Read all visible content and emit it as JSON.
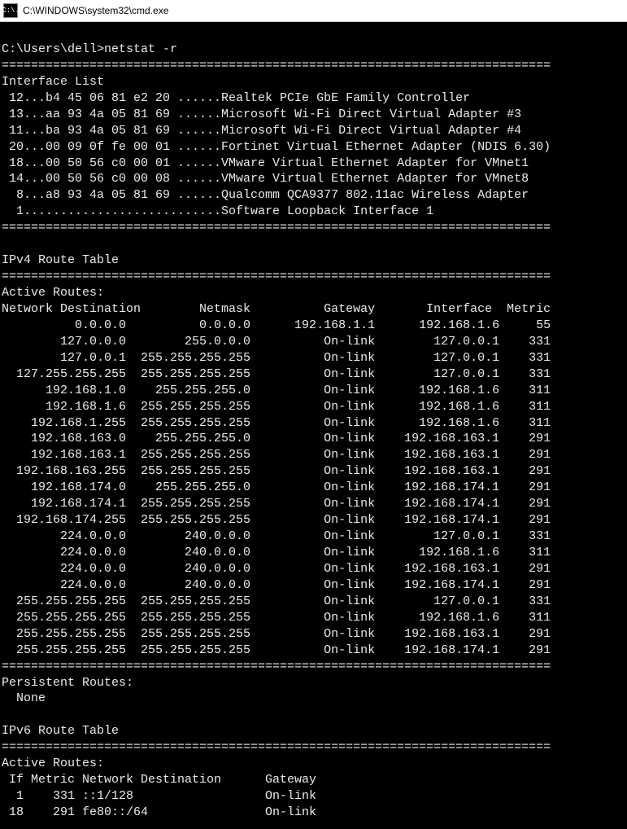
{
  "window": {
    "icon_text": "C:\\.",
    "title": "C:\\WINDOWS\\system32\\cmd.exe"
  },
  "terminal": {
    "prompt": "C:\\Users\\dell>",
    "command": "netstat -r",
    "divider": "===========================================================================",
    "interface_list_header": "Interface List",
    "interfaces": [
      {
        "idx": "12",
        "mac": "b4 45 06 81 e2 20",
        "name": "Realtek PCIe GbE Family Controller"
      },
      {
        "idx": "13",
        "mac": "aa 93 4a 05 81 69",
        "name": "Microsoft Wi-Fi Direct Virtual Adapter #3"
      },
      {
        "idx": "11",
        "mac": "ba 93 4a 05 81 69",
        "name": "Microsoft Wi-Fi Direct Virtual Adapter #4"
      },
      {
        "idx": "20",
        "mac": "00 09 0f fe 00 01",
        "name": "Fortinet Virtual Ethernet Adapter (NDIS 6.30)"
      },
      {
        "idx": "18",
        "mac": "00 50 56 c0 00 01",
        "name": "VMware Virtual Ethernet Adapter for VMnet1"
      },
      {
        "idx": "14",
        "mac": "00 50 56 c0 00 08",
        "name": "VMware Virtual Ethernet Adapter for VMnet8"
      },
      {
        "idx": "8",
        "mac": "a8 93 4a 05 81 69",
        "name": "Qualcomm QCA9377 802.11ac Wireless Adapter"
      }
    ],
    "loopback_line": "  1...........................Software Loopback Interface 1",
    "ipv4_header": "IPv4 Route Table",
    "active_routes_header": "Active Routes:",
    "ipv4_columns": "Network Destination        Netmask          Gateway       Interface  Metric",
    "ipv4_routes": [
      {
        "dest": "0.0.0.0",
        "mask": "0.0.0.0",
        "gw": "192.168.1.1",
        "iface": "192.168.1.6",
        "metric": "55"
      },
      {
        "dest": "127.0.0.0",
        "mask": "255.0.0.0",
        "gw": "On-link",
        "iface": "127.0.0.1",
        "metric": "331"
      },
      {
        "dest": "127.0.0.1",
        "mask": "255.255.255.255",
        "gw": "On-link",
        "iface": "127.0.0.1",
        "metric": "331"
      },
      {
        "dest": "127.255.255.255",
        "mask": "255.255.255.255",
        "gw": "On-link",
        "iface": "127.0.0.1",
        "metric": "331"
      },
      {
        "dest": "192.168.1.0",
        "mask": "255.255.255.0",
        "gw": "On-link",
        "iface": "192.168.1.6",
        "metric": "311"
      },
      {
        "dest": "192.168.1.6",
        "mask": "255.255.255.255",
        "gw": "On-link",
        "iface": "192.168.1.6",
        "metric": "311"
      },
      {
        "dest": "192.168.1.255",
        "mask": "255.255.255.255",
        "gw": "On-link",
        "iface": "192.168.1.6",
        "metric": "311"
      },
      {
        "dest": "192.168.163.0",
        "mask": "255.255.255.0",
        "gw": "On-link",
        "iface": "192.168.163.1",
        "metric": "291"
      },
      {
        "dest": "192.168.163.1",
        "mask": "255.255.255.255",
        "gw": "On-link",
        "iface": "192.168.163.1",
        "metric": "291"
      },
      {
        "dest": "192.168.163.255",
        "mask": "255.255.255.255",
        "gw": "On-link",
        "iface": "192.168.163.1",
        "metric": "291"
      },
      {
        "dest": "192.168.174.0",
        "mask": "255.255.255.0",
        "gw": "On-link",
        "iface": "192.168.174.1",
        "metric": "291"
      },
      {
        "dest": "192.168.174.1",
        "mask": "255.255.255.255",
        "gw": "On-link",
        "iface": "192.168.174.1",
        "metric": "291"
      },
      {
        "dest": "192.168.174.255",
        "mask": "255.255.255.255",
        "gw": "On-link",
        "iface": "192.168.174.1",
        "metric": "291"
      },
      {
        "dest": "224.0.0.0",
        "mask": "240.0.0.0",
        "gw": "On-link",
        "iface": "127.0.0.1",
        "metric": "331"
      },
      {
        "dest": "224.0.0.0",
        "mask": "240.0.0.0",
        "gw": "On-link",
        "iface": "192.168.1.6",
        "metric": "311"
      },
      {
        "dest": "224.0.0.0",
        "mask": "240.0.0.0",
        "gw": "On-link",
        "iface": "192.168.163.1",
        "metric": "291"
      },
      {
        "dest": "224.0.0.0",
        "mask": "240.0.0.0",
        "gw": "On-link",
        "iface": "192.168.174.1",
        "metric": "291"
      },
      {
        "dest": "255.255.255.255",
        "mask": "255.255.255.255",
        "gw": "On-link",
        "iface": "127.0.0.1",
        "metric": "331"
      },
      {
        "dest": "255.255.255.255",
        "mask": "255.255.255.255",
        "gw": "On-link",
        "iface": "192.168.1.6",
        "metric": "311"
      },
      {
        "dest": "255.255.255.255",
        "mask": "255.255.255.255",
        "gw": "On-link",
        "iface": "192.168.163.1",
        "metric": "291"
      },
      {
        "dest": "255.255.255.255",
        "mask": "255.255.255.255",
        "gw": "On-link",
        "iface": "192.168.174.1",
        "metric": "291"
      }
    ],
    "persistent_header": "Persistent Routes:",
    "persistent_none": "  None",
    "ipv6_header": "IPv6 Route Table",
    "ipv6_columns": " If Metric Network Destination      Gateway",
    "ipv6_routes": [
      {
        "if": "1",
        "metric": "331",
        "dest": "::1/128",
        "gw": "On-link"
      },
      {
        "if": "18",
        "metric": "291",
        "dest": "fe80::/64",
        "gw": "On-link"
      }
    ]
  }
}
